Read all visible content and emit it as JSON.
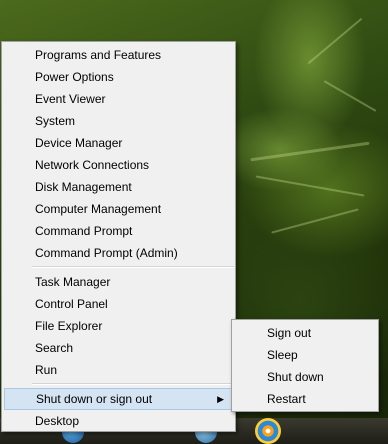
{
  "context_menu": {
    "group1": [
      "Programs and Features",
      "Power Options",
      "Event Viewer",
      "System",
      "Device Manager",
      "Network Connections",
      "Disk Management",
      "Computer Management",
      "Command Prompt",
      "Command Prompt (Admin)"
    ],
    "group2": [
      "Task Manager",
      "Control Panel",
      "File Explorer",
      "Search",
      "Run"
    ],
    "shutdown_label": "Shut down or sign out",
    "desktop_label": "Desktop"
  },
  "submenu": {
    "items": [
      "Sign out",
      "Sleep",
      "Shut down",
      "Restart"
    ]
  },
  "colors": {
    "menu_background": "#f0f0f0",
    "highlight": "#d5e4f2",
    "highlight_border": "#a8c8e8"
  }
}
